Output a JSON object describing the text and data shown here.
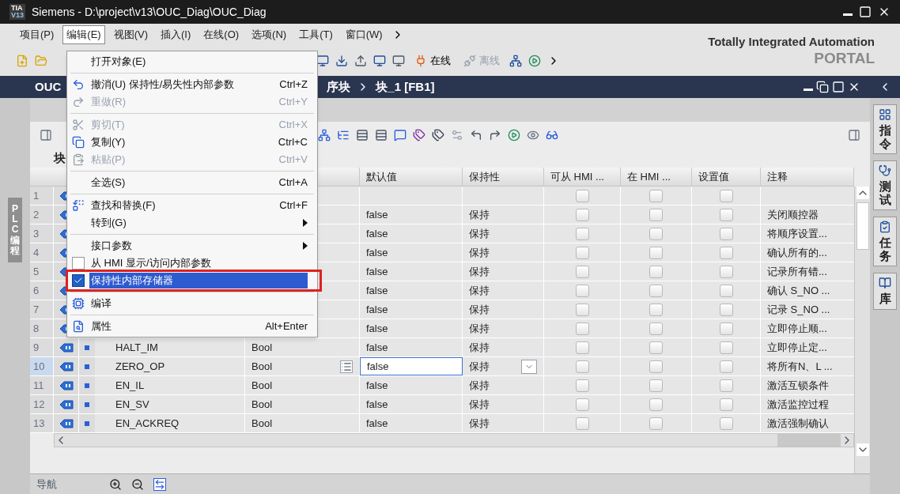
{
  "window": {
    "logo_top": "TIA",
    "logo_bottom": "V13",
    "title": "Siemens - D:\\project\\v13\\OUC_Diag\\OUC_Diag"
  },
  "menu_bar": [
    {
      "label": "项目(P)",
      "selected": false
    },
    {
      "label": "编辑(E)",
      "selected": true
    },
    {
      "label": "视图(V)",
      "selected": false
    },
    {
      "label": "插入(I)",
      "selected": false
    },
    {
      "label": "在线(O)",
      "selected": false
    },
    {
      "label": "选项(N)",
      "selected": false
    },
    {
      "label": "工具(T)",
      "selected": false
    },
    {
      "label": "窗口(W)",
      "selected": false
    }
  ],
  "toolbar": [
    {
      "label": "在线",
      "disabled": false
    },
    {
      "label": "离线",
      "disabled": true
    }
  ],
  "branding": {
    "line1": "Totally Integrated Automation",
    "line2": "PORTAL"
  },
  "editor": {
    "breadcrumb": [
      "OUC",
      "序块",
      "块_1 [FB1]"
    ],
    "block_label": "块",
    "left_tab": "PLC 编程",
    "right_tabs": [
      {
        "label": "指令",
        "kind": "grid"
      },
      {
        "label": "测试",
        "kind": "probe"
      },
      {
        "label": "任务",
        "kind": "task"
      },
      {
        "label": "库",
        "kind": "book"
      }
    ]
  },
  "table": {
    "columns": [
      "默认值",
      "保持性",
      "可从 HMI ...",
      "在 HMI ...",
      "设置值",
      "注释"
    ],
    "rows": [
      {
        "number": "1",
        "selected": false,
        "hmi_access": false,
        "hmi_visible": false,
        "setpoint": false
      },
      {
        "number": "2",
        "default": "false",
        "retain": "保持",
        "comment": "关闭顺控器",
        "selected": false,
        "hmi_access": false,
        "hmi_visible": false,
        "setpoint": false
      },
      {
        "number": "3",
        "default": "false",
        "retain": "保持",
        "comment": "将顺序设置...",
        "selected": false,
        "hmi_access": false,
        "hmi_visible": false,
        "setpoint": false
      },
      {
        "number": "4",
        "default": "false",
        "retain": "保持",
        "comment": "确认所有的...",
        "selected": false,
        "hmi_access": false,
        "hmi_visible": false,
        "setpoint": false
      },
      {
        "number": "5",
        "default": "false",
        "retain": "保持",
        "comment": "记录所有错...",
        "selected": false,
        "hmi_access": false,
        "hmi_visible": false,
        "setpoint": false
      },
      {
        "number": "6",
        "default": "false",
        "retain": "保持",
        "comment": "确认 S_NO ...",
        "selected": false,
        "hmi_access": false,
        "hmi_visible": false,
        "setpoint": false
      },
      {
        "number": "7",
        "default": "false",
        "retain": "保持",
        "comment": "记录 S_NO ...",
        "selected": false,
        "hmi_access": false,
        "hmi_visible": false,
        "setpoint": false
      },
      {
        "number": "8",
        "default": "false",
        "retain": "保持",
        "comment": "立即停止顺...",
        "selected": false,
        "hmi_access": false,
        "hmi_visible": false,
        "setpoint": false
      },
      {
        "number": "9",
        "name": "HALT_IM",
        "type": "Bool",
        "default": "false",
        "retain": "保持",
        "comment": "立即停止定...",
        "selected": false,
        "hmi_access": false,
        "hmi_visible": false,
        "setpoint": false
      },
      {
        "number": "10",
        "name": "ZERO_OP",
        "type": "Bool",
        "default": "false",
        "retain": "保持",
        "comment": "将所有N、L ...",
        "selected": true,
        "hmi_access": false,
        "hmi_visible": false,
        "setpoint": false
      },
      {
        "number": "11",
        "name": "EN_IL",
        "type": "Bool",
        "default": "false",
        "retain": "保持",
        "comment": "激活互锁条件",
        "selected": false,
        "hmi_access": false,
        "hmi_visible": false,
        "setpoint": false
      },
      {
        "number": "12",
        "name": "EN_SV",
        "type": "Bool",
        "default": "false",
        "retain": "保持",
        "comment": "激活监控过程",
        "selected": false,
        "hmi_access": false,
        "hmi_visible": false,
        "setpoint": false
      },
      {
        "number": "13",
        "name": "EN_ACKREQ",
        "type": "Bool",
        "default": "false",
        "retain": "保持",
        "comment": "激活强制确认",
        "selected": false,
        "hmi_access": false,
        "hmi_visible": false,
        "setpoint": false
      }
    ]
  },
  "edit_menu": [
    {
      "kind": "item",
      "label": "打开对象(E)",
      "disabled": false
    },
    {
      "kind": "separator"
    },
    {
      "kind": "item",
      "label": "撤消(U) 保持性/易失性内部参数",
      "shortcut": "Ctrl+Z",
      "disabled": false
    },
    {
      "kind": "item",
      "label": "重做(R)",
      "shortcut": "Ctrl+Y",
      "disabled": true
    },
    {
      "kind": "separator"
    },
    {
      "kind": "item",
      "label": "剪切(T)",
      "shortcut": "Ctrl+X",
      "disabled": true
    },
    {
      "kind": "item",
      "label": "复制(Y)",
      "shortcut": "Ctrl+C",
      "disabled": false
    },
    {
      "kind": "item",
      "label": "粘贴(P)",
      "shortcut": "Ctrl+V",
      "disabled": true
    },
    {
      "kind": "separator"
    },
    {
      "kind": "item",
      "label": "全选(S)",
      "shortcut": "Ctrl+A",
      "disabled": false
    },
    {
      "kind": "separator"
    },
    {
      "kind": "item",
      "label": "查找和替换(F)",
      "shortcut": "Ctrl+F",
      "disabled": false
    },
    {
      "kind": "submenu",
      "label": "转到(G)"
    },
    {
      "kind": "separator"
    },
    {
      "kind": "submenu",
      "label": "接口参数"
    },
    {
      "kind": "checkbox",
      "label": "从 HMI 显示/访问内部参数",
      "checked": false,
      "selected": false
    },
    {
      "kind": "checkbox",
      "label": "保持性内部存储器",
      "checked": true,
      "selected": true
    },
    {
      "kind": "separator"
    },
    {
      "kind": "item",
      "label": "编译",
      "disabled": false
    },
    {
      "kind": "separator"
    },
    {
      "kind": "item",
      "label": "属性",
      "shortcut": "Alt+Enter",
      "disabled": false
    }
  ],
  "navigation": {
    "label": "导航"
  }
}
